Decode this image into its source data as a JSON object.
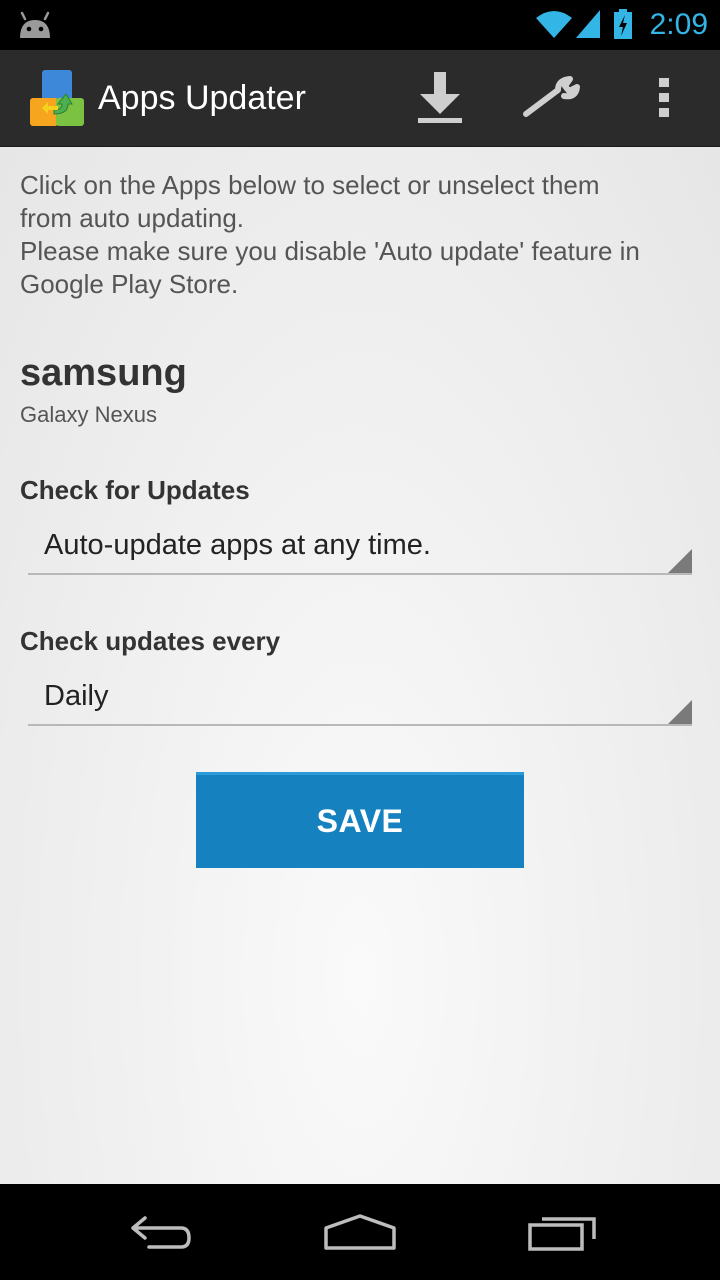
{
  "status_bar": {
    "time": "2:09",
    "icons": [
      "android-icon",
      "wifi-icon",
      "signal-icon",
      "battery-charging-icon"
    ],
    "accent_color": "#33b5e5"
  },
  "action_bar": {
    "title": "Apps Updater",
    "actions": [
      "download-icon",
      "wrench-icon",
      "overflow-menu-icon"
    ]
  },
  "intro": {
    "line1": "Click on the Apps below to select or unselect them",
    "line2": "from auto updating.",
    "line3": "Please make sure you disable 'Auto update' feature in",
    "line4": "Google Play Store."
  },
  "device": {
    "manufacturer": "samsung",
    "model": "Galaxy Nexus"
  },
  "check_for_updates": {
    "label": "Check for Updates",
    "selected": "Auto-update apps at any time."
  },
  "check_every": {
    "label": "Check updates every",
    "selected": "Daily"
  },
  "save_button": {
    "label": "SAVE",
    "color": "#1681bf"
  },
  "nav_bar": {
    "buttons": [
      "back-icon",
      "home-icon",
      "recents-icon"
    ]
  }
}
